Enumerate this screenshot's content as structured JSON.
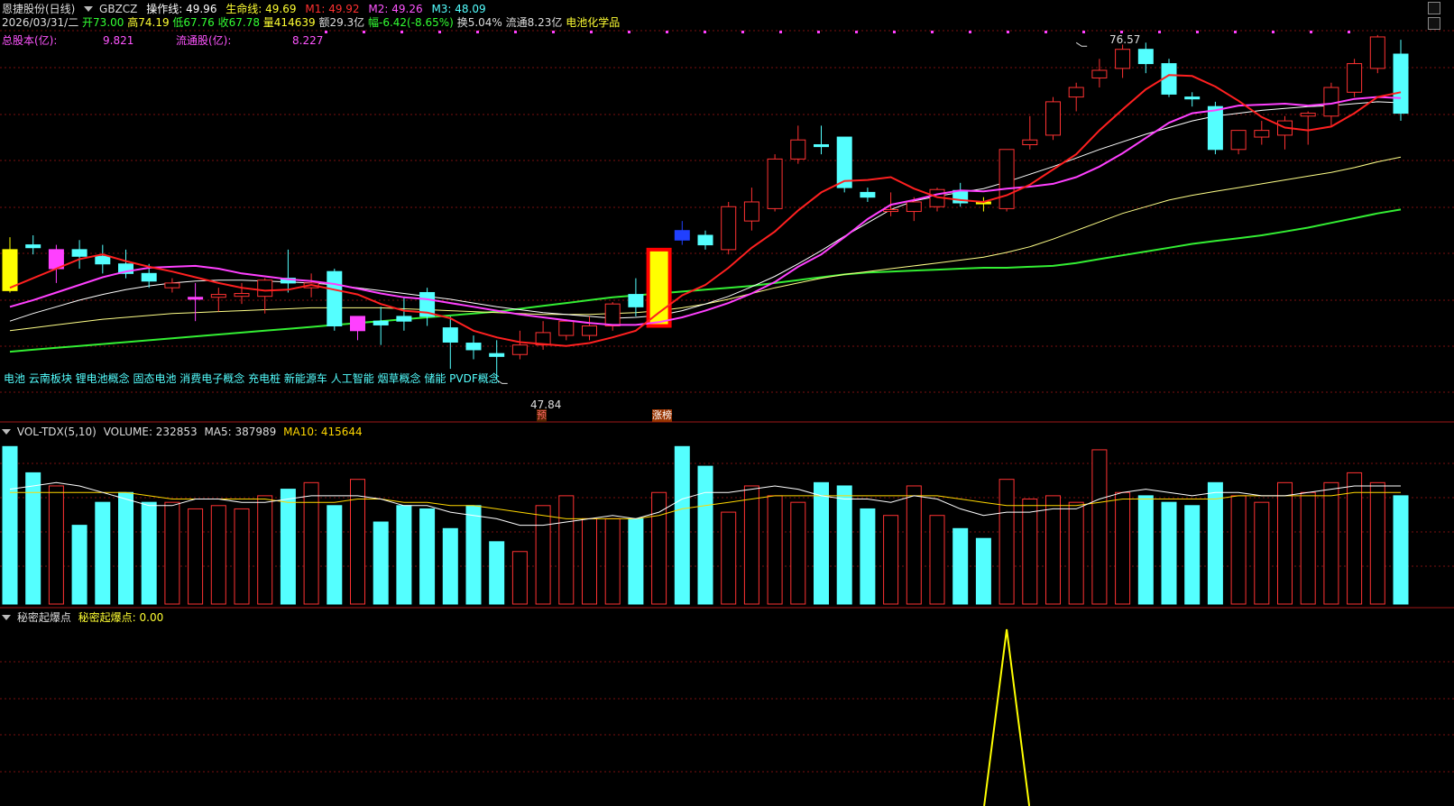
{
  "colors": {
    "up": "#ff3232",
    "down": "#54ffff",
    "ma5": "#ff2020",
    "ma10": "#ff40ff",
    "ma20": "#ffffff",
    "ma60": "#ffff88",
    "ma120": "#33ee33",
    "grid": "#7a1010",
    "vol_ma5": "#ffffff",
    "vol_ma10": "#ffd700",
    "text_blue": "#54ffff",
    "text_yellow": "#ffff33",
    "text_magenta": "#ff55ff"
  },
  "header": {
    "stock_name": "恩捷股份(日线)",
    "code": "GBZCZ",
    "op_label": "操作线:",
    "op_value": "49.96",
    "life_label": "生命线:",
    "life_value": "49.69",
    "m1_label": "M1:",
    "m1_value": "49.92",
    "m2_label": "M2:",
    "m2_value": "49.26",
    "m3_label": "M3:",
    "m3_value": "48.09"
  },
  "quote": {
    "date": "2026/03/31/二",
    "open": "开73.00",
    "high": "高74.19",
    "low": "低67.76",
    "close": "收67.78",
    "volume": "量414639",
    "amount": "额29.3亿",
    "change": "幅-6.42(-8.65%)",
    "turnover": "换5.04%",
    "float_value": "流通8.23亿",
    "industry": "电池化学品"
  },
  "capital": {
    "total_label": "总股本(亿):",
    "total_value": "9.821",
    "float_label": "流通股(亿):",
    "float_value": "8.227"
  },
  "concepts": "电池 云南板块 锂电池概念 固态电池 消费电子概念 充电桩 新能源车 人工智能 烟草概念 储能 PVDF概念",
  "annotations": {
    "high_price": "76.57",
    "low_price": "47.84",
    "tag_yu": "预",
    "tag_zhangting": "涨榜"
  },
  "vol_header": {
    "name": "VOL-TDX(5,10)",
    "volume": "VOLUME: 232853",
    "ma5": "MA5: 387989",
    "ma10": "MA10: 415644"
  },
  "secret_header": {
    "name": "秘密起爆点",
    "label": "秘密起爆点:",
    "value": "0.00"
  },
  "chart_data": {
    "type": "candlestick",
    "price_range": [
      44,
      82
    ],
    "grid": true,
    "candles": [
      {
        "o": 61.5,
        "h": 62.8,
        "l": 57.0,
        "c": 57.2
      },
      {
        "o": 62.0,
        "h": 63.0,
        "l": 61.0,
        "c": 61.7
      },
      {
        "o": 59.5,
        "h": 62.0,
        "l": 58.0,
        "c": 61.5
      },
      {
        "o": 61.5,
        "h": 62.5,
        "l": 59.5,
        "c": 60.8
      },
      {
        "o": 60.8,
        "h": 62.0,
        "l": 59.0,
        "c": 60.0
      },
      {
        "o": 60.0,
        "h": 61.5,
        "l": 58.5,
        "c": 59.0
      },
      {
        "o": 59.0,
        "h": 60.0,
        "l": 57.5,
        "c": 58.2
      },
      {
        "o": 57.5,
        "h": 58.5,
        "l": 57.0,
        "c": 58.0
      },
      {
        "o": 56.3,
        "h": 58.0,
        "l": 54.0,
        "c": 56.5
      },
      {
        "o": 56.5,
        "h": 57.5,
        "l": 55.0,
        "c": 56.8
      },
      {
        "o": 56.6,
        "h": 58.0,
        "l": 55.8,
        "c": 56.9
      },
      {
        "o": 56.6,
        "h": 58.5,
        "l": 54.8,
        "c": 58.3
      },
      {
        "o": 58.5,
        "h": 61.5,
        "l": 57.0,
        "c": 58.0
      },
      {
        "o": 57.5,
        "h": 59.0,
        "l": 56.5,
        "c": 58.0
      },
      {
        "o": 59.2,
        "h": 59.5,
        "l": 53.0,
        "c": 53.5
      },
      {
        "o": 53.0,
        "h": 54.5,
        "l": 52.0,
        "c": 54.5
      },
      {
        "o": 54.0,
        "h": 55.5,
        "l": 51.5,
        "c": 53.6
      },
      {
        "o": 54.5,
        "h": 56.5,
        "l": 53.0,
        "c": 54.0
      },
      {
        "o": 57.0,
        "h": 57.5,
        "l": 53.5,
        "c": 54.5
      },
      {
        "o": 53.3,
        "h": 54.5,
        "l": 49.0,
        "c": 51.8
      },
      {
        "o": 51.7,
        "h": 52.5,
        "l": 50.0,
        "c": 51.0
      },
      {
        "o": 50.6,
        "h": 52.0,
        "l": 47.84,
        "c": 50.3
      },
      {
        "o": 50.5,
        "h": 53.0,
        "l": 50.0,
        "c": 51.5
      },
      {
        "o": 51.5,
        "h": 54.0,
        "l": 51.0,
        "c": 52.8
      },
      {
        "o": 52.5,
        "h": 54.2,
        "l": 52.0,
        "c": 54.0
      },
      {
        "o": 52.5,
        "h": 54.5,
        "l": 52.0,
        "c": 53.5
      },
      {
        "o": 53.5,
        "h": 56.0,
        "l": 53.0,
        "c": 55.8
      },
      {
        "o": 56.8,
        "h": 58.5,
        "l": 54.5,
        "c": 55.5
      },
      {
        "o": 53.5,
        "h": 61.5,
        "l": 53.5,
        "c": 61.5
      },
      {
        "o": 63.5,
        "h": 64.5,
        "l": 62.0,
        "c": 62.5
      },
      {
        "o": 63.0,
        "h": 63.5,
        "l": 61.5,
        "c": 62.0
      },
      {
        "o": 61.5,
        "h": 66.5,
        "l": 61.0,
        "c": 66.0
      },
      {
        "o": 64.5,
        "h": 68.0,
        "l": 63.5,
        "c": 66.5
      },
      {
        "o": 65.8,
        "h": 71.5,
        "l": 65.5,
        "c": 71.0
      },
      {
        "o": 71.0,
        "h": 74.5,
        "l": 70.5,
        "c": 73.0
      },
      {
        "o": 72.5,
        "h": 74.5,
        "l": 71.5,
        "c": 72.3
      },
      {
        "o": 73.3,
        "h": 73.3,
        "l": 67.5,
        "c": 68.0
      },
      {
        "o": 67.5,
        "h": 68.0,
        "l": 66.5,
        "c": 67.0
      },
      {
        "o": 65.5,
        "h": 67.5,
        "l": 65.0,
        "c": 65.7
      },
      {
        "o": 65.5,
        "h": 67.0,
        "l": 64.5,
        "c": 66.5
      },
      {
        "o": 66.0,
        "h": 68.0,
        "l": 65.5,
        "c": 67.8
      },
      {
        "o": 67.7,
        "h": 68.5,
        "l": 66.0,
        "c": 66.4
      },
      {
        "o": 66.5,
        "h": 67.0,
        "l": 65.5,
        "c": 66.3
      },
      {
        "o": 65.8,
        "h": 72.0,
        "l": 65.5,
        "c": 72.0
      },
      {
        "o": 72.5,
        "h": 75.5,
        "l": 72.0,
        "c": 73.0
      },
      {
        "o": 73.5,
        "h": 77.5,
        "l": 73.0,
        "c": 77.0
      },
      {
        "o": 77.5,
        "h": 79.0,
        "l": 76.0,
        "c": 78.5
      },
      {
        "o": 79.5,
        "h": 81.5,
        "l": 78.5,
        "c": 80.3
      },
      {
        "o": 80.5,
        "h": 83.0,
        "l": 79.5,
        "c": 82.5
      },
      {
        "o": 82.5,
        "h": 83.2,
        "l": 80.0,
        "c": 81.0
      },
      {
        "o": 81.0,
        "h": 81.5,
        "l": 77.5,
        "c": 77.8
      },
      {
        "o": 77.5,
        "h": 78.0,
        "l": 76.5,
        "c": 77.3
      },
      {
        "o": 76.5,
        "h": 77.0,
        "l": 71.5,
        "c": 72.0
      },
      {
        "o": 72.0,
        "h": 74.0,
        "l": 71.5,
        "c": 74.0
      },
      {
        "o": 73.3,
        "h": 75.0,
        "l": 72.5,
        "c": 74.0
      },
      {
        "o": 73.5,
        "h": 75.5,
        "l": 72.0,
        "c": 75.0
      },
      {
        "o": 75.5,
        "h": 76.0,
        "l": 72.5,
        "c": 75.8
      },
      {
        "o": 75.5,
        "h": 79.0,
        "l": 74.5,
        "c": 78.5
      },
      {
        "o": 78.0,
        "h": 81.5,
        "l": 77.5,
        "c": 81.0
      },
      {
        "o": 80.5,
        "h": 84.0,
        "l": 80.0,
        "c": 83.8
      },
      {
        "o": 82.0,
        "h": 83.5,
        "l": 75.0,
        "c": 75.8
      }
    ],
    "ma5": [
      57.5,
      58.5,
      59.5,
      60.5,
      61.0,
      60.3,
      59.7,
      59.2,
      58.6,
      58.0,
      57.5,
      57.2,
      57.3,
      57.8,
      57.3,
      56.8,
      55.8,
      55.1,
      54.9,
      54.3,
      53.0,
      52.3,
      51.8,
      51.6,
      51.4,
      51.7,
      52.3,
      53.0,
      54.9,
      56.7,
      57.8,
      59.6,
      61.7,
      63.4,
      65.6,
      67.5,
      68.7,
      68.8,
      69.1,
      67.9,
      67.0,
      66.7,
      66.5,
      67.2,
      68.3,
      69.9,
      71.5,
      74.0,
      76.2,
      78.3,
      79.8,
      79.7,
      78.6,
      77.1,
      75.4,
      74.3,
      74.0,
      74.4,
      75.8,
      77.5,
      78.0
    ],
    "ma10": [
      55.5,
      56.2,
      57.0,
      57.8,
      58.6,
      59.2,
      59.6,
      59.7,
      59.8,
      59.5,
      59.0,
      58.7,
      58.4,
      58.2,
      57.9,
      57.4,
      56.9,
      56.5,
      56.3,
      55.9,
      55.5,
      55.1,
      54.7,
      54.4,
      54.1,
      53.8,
      53.6,
      53.6,
      53.9,
      54.4,
      55.1,
      55.9,
      56.9,
      58.1,
      59.7,
      61.0,
      62.8,
      64.7,
      66.2,
      66.7,
      67.3,
      67.7,
      67.6,
      67.9,
      68.1,
      68.4,
      69.1,
      70.2,
      71.6,
      73.2,
      74.8,
      75.8,
      76.1,
      76.6,
      76.7,
      76.8,
      76.6,
      76.8,
      77.3,
      77.5,
      77.4
    ],
    "ma20": [
      54.0,
      54.8,
      55.5,
      56.2,
      56.8,
      57.3,
      57.7,
      58.0,
      58.2,
      58.3,
      58.3,
      58.2,
      58.1,
      58.0,
      57.8,
      57.5,
      57.2,
      56.9,
      56.6,
      56.3,
      55.9,
      55.5,
      55.2,
      54.9,
      54.7,
      54.5,
      54.3,
      54.4,
      54.6,
      55.1,
      55.8,
      56.6,
      57.6,
      58.7,
      60.0,
      61.4,
      62.9,
      64.3,
      65.7,
      66.6,
      67.1,
      67.5,
      67.9,
      68.6,
      69.4,
      70.2,
      71.1,
      72.0,
      72.8,
      73.6,
      74.3,
      75.0,
      75.5,
      75.8,
      76.1,
      76.3,
      76.5,
      76.6,
      76.8,
      77.0,
      76.9
    ],
    "ma60": [
      53.0,
      53.3,
      53.6,
      53.9,
      54.2,
      54.4,
      54.6,
      54.8,
      54.9,
      55.0,
      55.1,
      55.2,
      55.3,
      55.4,
      55.4,
      55.4,
      55.4,
      55.3,
      55.2,
      55.1,
      55.0,
      54.9,
      54.8,
      54.7,
      54.7,
      54.7,
      54.8,
      54.9,
      55.1,
      55.4,
      55.8,
      56.3,
      56.9,
      57.5,
      58.0,
      58.5,
      58.9,
      59.2,
      59.5,
      59.8,
      60.1,
      60.4,
      60.7,
      61.2,
      61.8,
      62.6,
      63.5,
      64.4,
      65.3,
      66.0,
      66.7,
      67.2,
      67.6,
      68.0,
      68.4,
      68.8,
      69.2,
      69.6,
      70.1,
      70.7,
      71.2
    ],
    "ma120": [
      50.8,
      51.0,
      51.2,
      51.4,
      51.6,
      51.8,
      52.0,
      52.2,
      52.4,
      52.6,
      52.8,
      53.0,
      53.2,
      53.4,
      53.6,
      53.8,
      54.0,
      54.2,
      54.4,
      54.6,
      54.8,
      55.0,
      55.3,
      55.6,
      55.9,
      56.2,
      56.5,
      56.7,
      56.9,
      57.1,
      57.3,
      57.5,
      57.7,
      58.0,
      58.3,
      58.6,
      58.9,
      59.1,
      59.2,
      59.3,
      59.4,
      59.5,
      59.6,
      59.6,
      59.7,
      59.8,
      60.1,
      60.5,
      60.9,
      61.3,
      61.7,
      62.1,
      62.4,
      62.7,
      63.0,
      63.4,
      63.8,
      64.3,
      64.8,
      65.3,
      65.7
    ],
    "volume": [
      480,
      400,
      360,
      240,
      310,
      340,
      310,
      310,
      290,
      300,
      290,
      330,
      350,
      370,
      300,
      380,
      250,
      300,
      290,
      230,
      300,
      190,
      160,
      300,
      330,
      260,
      260,
      260,
      340,
      480,
      420,
      280,
      360,
      330,
      310,
      370,
      360,
      290,
      270,
      360,
      270,
      230,
      200,
      380,
      320,
      330,
      310,
      470,
      340,
      330,
      310,
      300,
      370,
      330,
      310,
      370,
      340,
      370,
      400,
      370,
      330
    ],
    "vol_ma5": [
      350,
      360,
      370,
      360,
      340,
      320,
      300,
      300,
      320,
      320,
      310,
      310,
      320,
      330,
      330,
      330,
      320,
      300,
      300,
      280,
      270,
      260,
      240,
      240,
      250,
      260,
      270,
      260,
      280,
      320,
      340,
      340,
      350,
      360,
      350,
      330,
      320,
      320,
      310,
      330,
      320,
      290,
      270,
      280,
      280,
      290,
      290,
      320,
      340,
      350,
      340,
      330,
      340,
      340,
      330,
      330,
      340,
      350,
      360,
      360,
      360
    ],
    "vol_ma10": [
      340,
      340,
      340,
      340,
      340,
      340,
      330,
      320,
      320,
      320,
      320,
      320,
      310,
      310,
      310,
      320,
      320,
      310,
      310,
      300,
      300,
      290,
      280,
      270,
      260,
      260,
      260,
      260,
      270,
      290,
      300,
      310,
      320,
      330,
      330,
      330,
      330,
      330,
      330,
      330,
      330,
      320,
      310,
      300,
      300,
      300,
      300,
      310,
      320,
      320,
      320,
      320,
      320,
      330,
      330,
      330,
      330,
      330,
      340,
      340,
      340
    ],
    "secret_signal_index": 43,
    "secret_signal_peak": 1.0
  }
}
